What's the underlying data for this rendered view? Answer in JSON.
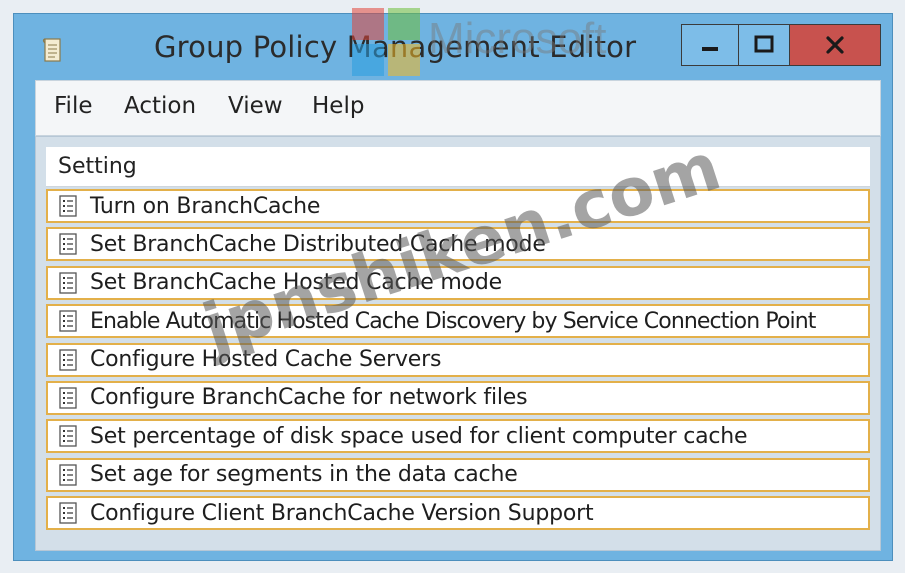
{
  "window": {
    "title": "Group Policy Management Editor",
    "watermark_brand": "Microsoft",
    "controls": {
      "minimize": "—",
      "maximize": "▢",
      "close": "x"
    }
  },
  "menu": {
    "items": [
      "File",
      "Action",
      "View",
      "Help"
    ]
  },
  "table": {
    "header": "Setting",
    "rows": [
      "Turn on BranchCache",
      "Set BranchCache Distributed Cache mode",
      "Set BranchCache Hosted Cache mode",
      "Enable Automatic Hosted Cache Discovery by Service Connection Point",
      "Configure Hosted Cache Servers",
      "Configure BranchCache for network files",
      "Set percentage of disk space used for client computer cache",
      "Set age for segments in the data cache",
      "Configure Client BranchCache Version Support"
    ]
  },
  "overlay_watermark": "jpnshiken.com",
  "colors": {
    "frame": "#6fb3e1",
    "close_button": "#c8524e",
    "row_border": "#e3b04a"
  },
  "icons": {
    "app": "policy-scroll-icon",
    "row": "policy-setting-icon"
  }
}
